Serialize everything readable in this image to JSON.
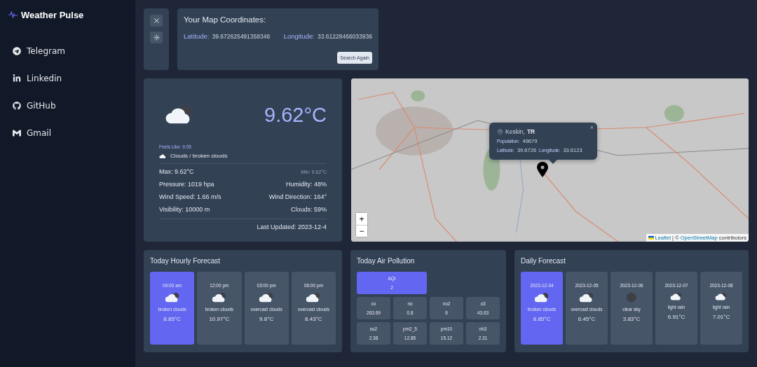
{
  "brand": {
    "title": "Weather Pulse"
  },
  "sidebar": {
    "items": [
      {
        "label": "Telegram",
        "kind": "telegram"
      },
      {
        "label": "Linkedin",
        "kind": "linkedin"
      },
      {
        "label": "GitHub",
        "kind": "github"
      },
      {
        "label": "Gmail",
        "kind": "gmail"
      }
    ]
  },
  "coordinates": {
    "title": "Your Map Coordinates:",
    "latitude_label": "Latitude:",
    "latitude": "39.672625491358346",
    "longitude_label": "Longitude:",
    "longitude": "33.61228466033936",
    "button": "Search Again"
  },
  "current": {
    "kind": "clouds",
    "temperature": "9.62°C",
    "feels_like": "Feels Like: 9.05",
    "condition": "Clouds / broken clouds",
    "max": "Max: 9.62°C",
    "min": "Min: 9.62°C",
    "details": [
      {
        "left": "Pressure: 1019 hpa",
        "right": "Humidity: 48%"
      },
      {
        "left": "Wind Speed: 1.66 m/s",
        "right": "Wind Direction: 164°"
      },
      {
        "left": "Visibility: 10000 m",
        "right": "Clouds: 59%"
      }
    ],
    "last_updated": "Last Updated: 2023-12-4"
  },
  "map": {
    "popup": {
      "close": "×",
      "city": "Keskin,",
      "country": "TR",
      "population_label": "Population:",
      "population": "49679",
      "latitude_label": "Latitude:",
      "latitude": "39.6726",
      "longitude_label": "Longitude:",
      "longitude": "33.6123"
    },
    "zoom_in": "+",
    "zoom_out": "−",
    "attribution": {
      "link": "Leaflet",
      "middle": " | © ",
      "source": "OpenStreetMap",
      "rest": " contributors"
    }
  },
  "hourly": {
    "title": "Today Hourly Forecast",
    "items": [
      {
        "time": "09:00 am",
        "kind": "clouds",
        "description": "broken clouds",
        "temperature": "8.85°C",
        "selected": true
      },
      {
        "time": "12:00 pm",
        "kind": "clouds",
        "description": "broken clouds",
        "temperature": "10.97°C",
        "selected": false
      },
      {
        "time": "03:00 pm",
        "kind": "clouds",
        "description": "overcast clouds",
        "temperature": "9.8°C",
        "selected": false
      },
      {
        "time": "06:00 pm",
        "kind": "clouds",
        "description": "overcast clouds",
        "temperature": "8.43°C",
        "selected": false
      }
    ]
  },
  "pollution": {
    "title": "Today Air Pollution",
    "aqi": {
      "label": "AQI",
      "value": "2"
    },
    "items": [
      {
        "label": "co",
        "value": "263.69"
      },
      {
        "label": "no",
        "value": "0.8"
      },
      {
        "label": "no2",
        "value": "6"
      },
      {
        "label": "o3",
        "value": "43.63"
      },
      {
        "label": "so2",
        "value": "2.38"
      },
      {
        "label": "pm2_5",
        "value": "12.85"
      },
      {
        "label": "pm10",
        "value": "15.12"
      },
      {
        "label": "nh3",
        "value": "2.31"
      }
    ]
  },
  "daily": {
    "title": "Daily Forecast",
    "items": [
      {
        "date": "2023-12-04",
        "kind": "clouds",
        "description": "broken clouds",
        "temperature": "8.85°C",
        "selected": true
      },
      {
        "date": "2023-12-05",
        "kind": "clouds",
        "description": "overcast clouds",
        "temperature": "6.45°C",
        "selected": false
      },
      {
        "date": "2023-12-06",
        "kind": "clear",
        "description": "clear sky",
        "temperature": "3.83°C",
        "selected": false
      },
      {
        "date": "2023-12-07",
        "kind": "rain",
        "description": "light rain",
        "temperature": "6.91°C",
        "selected": false
      },
      {
        "date": "2023-12-08",
        "kind": "rain",
        "description": "light rain",
        "temperature": "7.01°C",
        "selected": false
      }
    ]
  }
}
